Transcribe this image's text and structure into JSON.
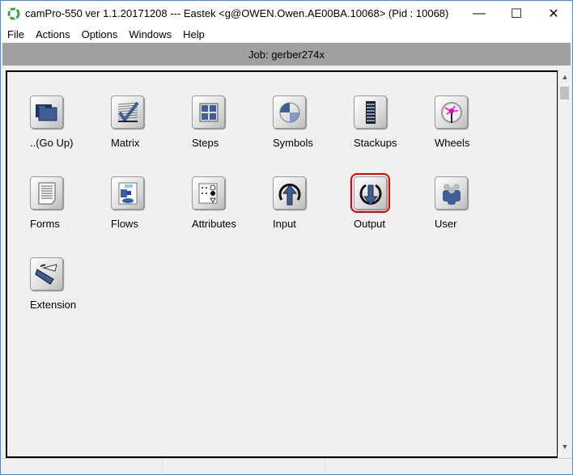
{
  "window": {
    "title": "camPro-550 ver 1.1.20171208 --- Eastek <g@OWEN.Owen.AE00BA.10068> (Pid : 10068)",
    "minimize": "—",
    "maximize": "☐",
    "close": "✕"
  },
  "menu": [
    "File",
    "Actions",
    "Options",
    "Windows",
    "Help"
  ],
  "job": {
    "label": "Job: gerber274x"
  },
  "items": [
    {
      "label": "..(Go Up)",
      "icon": "folder-up-icon"
    },
    {
      "label": "Matrix",
      "icon": "matrix-icon"
    },
    {
      "label": "Steps",
      "icon": "steps-icon"
    },
    {
      "label": "Symbols",
      "icon": "symbols-icon"
    },
    {
      "label": "Stackups",
      "icon": "stackups-icon"
    },
    {
      "label": "Wheels",
      "icon": "wheels-icon"
    },
    {
      "label": "Forms",
      "icon": "forms-icon"
    },
    {
      "label": "Flows",
      "icon": "flows-icon"
    },
    {
      "label": "Attributes",
      "icon": "attributes-icon"
    },
    {
      "label": "Input",
      "icon": "input-icon"
    },
    {
      "label": "Output",
      "icon": "output-icon",
      "selected": true
    },
    {
      "label": "User",
      "icon": "user-icon"
    },
    {
      "label": "Extension",
      "icon": "extension-icon"
    }
  ],
  "colors": {
    "selection": "#e00000",
    "jobbar": "#a0a0a0",
    "iconBlue": "#3d5f95"
  }
}
